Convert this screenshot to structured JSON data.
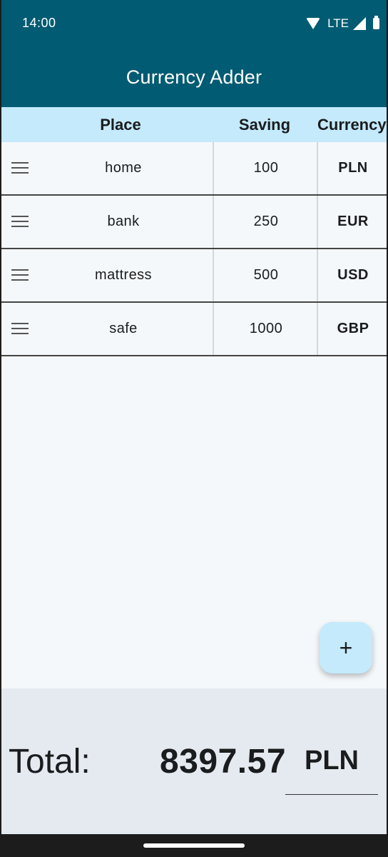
{
  "status_bar": {
    "time": "14:00",
    "network": "LTE"
  },
  "app_bar": {
    "title": "Currency Adder"
  },
  "table": {
    "headers": {
      "place": "Place",
      "saving": "Saving",
      "currency": "Currency"
    },
    "rows": [
      {
        "place": "home",
        "saving": "100",
        "currency": "PLN"
      },
      {
        "place": "bank",
        "saving": "250",
        "currency": "EUR"
      },
      {
        "place": "mattress",
        "saving": "500",
        "currency": "USD"
      },
      {
        "place": "safe",
        "saving": "1000",
        "currency": "GBP"
      }
    ]
  },
  "fab": {
    "icon": "plus-icon",
    "label": "+"
  },
  "footer": {
    "total_label": "Total:",
    "total_value": "8397.57",
    "total_currency": "PLN"
  },
  "colors": {
    "primary": "#015b72",
    "header_bg": "#c4eafc",
    "background": "#f5f8fb",
    "footer_bg": "#e4eaf0"
  }
}
